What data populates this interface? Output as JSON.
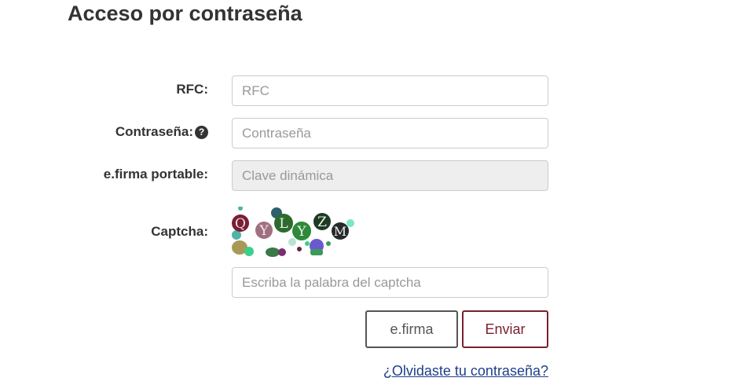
{
  "page": {
    "title": "Acceso por contraseña"
  },
  "form": {
    "rfc": {
      "label": "RFC:",
      "placeholder": "RFC"
    },
    "password": {
      "label": "Contraseña:",
      "placeholder": "Contraseña",
      "help_icon": "question-circle-icon"
    },
    "efirma_portable": {
      "label": "e.firma portable:",
      "placeholder": "Clave dinámica",
      "disabled": true
    },
    "captcha": {
      "label": "Captcha:",
      "letters": [
        "Q",
        "Y",
        "L",
        "Y",
        "Z",
        "M"
      ],
      "input_placeholder": "Escriba la palabra del captcha"
    }
  },
  "buttons": {
    "efirma_label": "e.firma",
    "enviar_label": "Enviar"
  },
  "links": {
    "forgot_password": "¿Olvidaste tu contraseña?"
  },
  "colors": {
    "accent": "#7b1f2e",
    "link": "#1f3f8a",
    "text": "#333333"
  }
}
